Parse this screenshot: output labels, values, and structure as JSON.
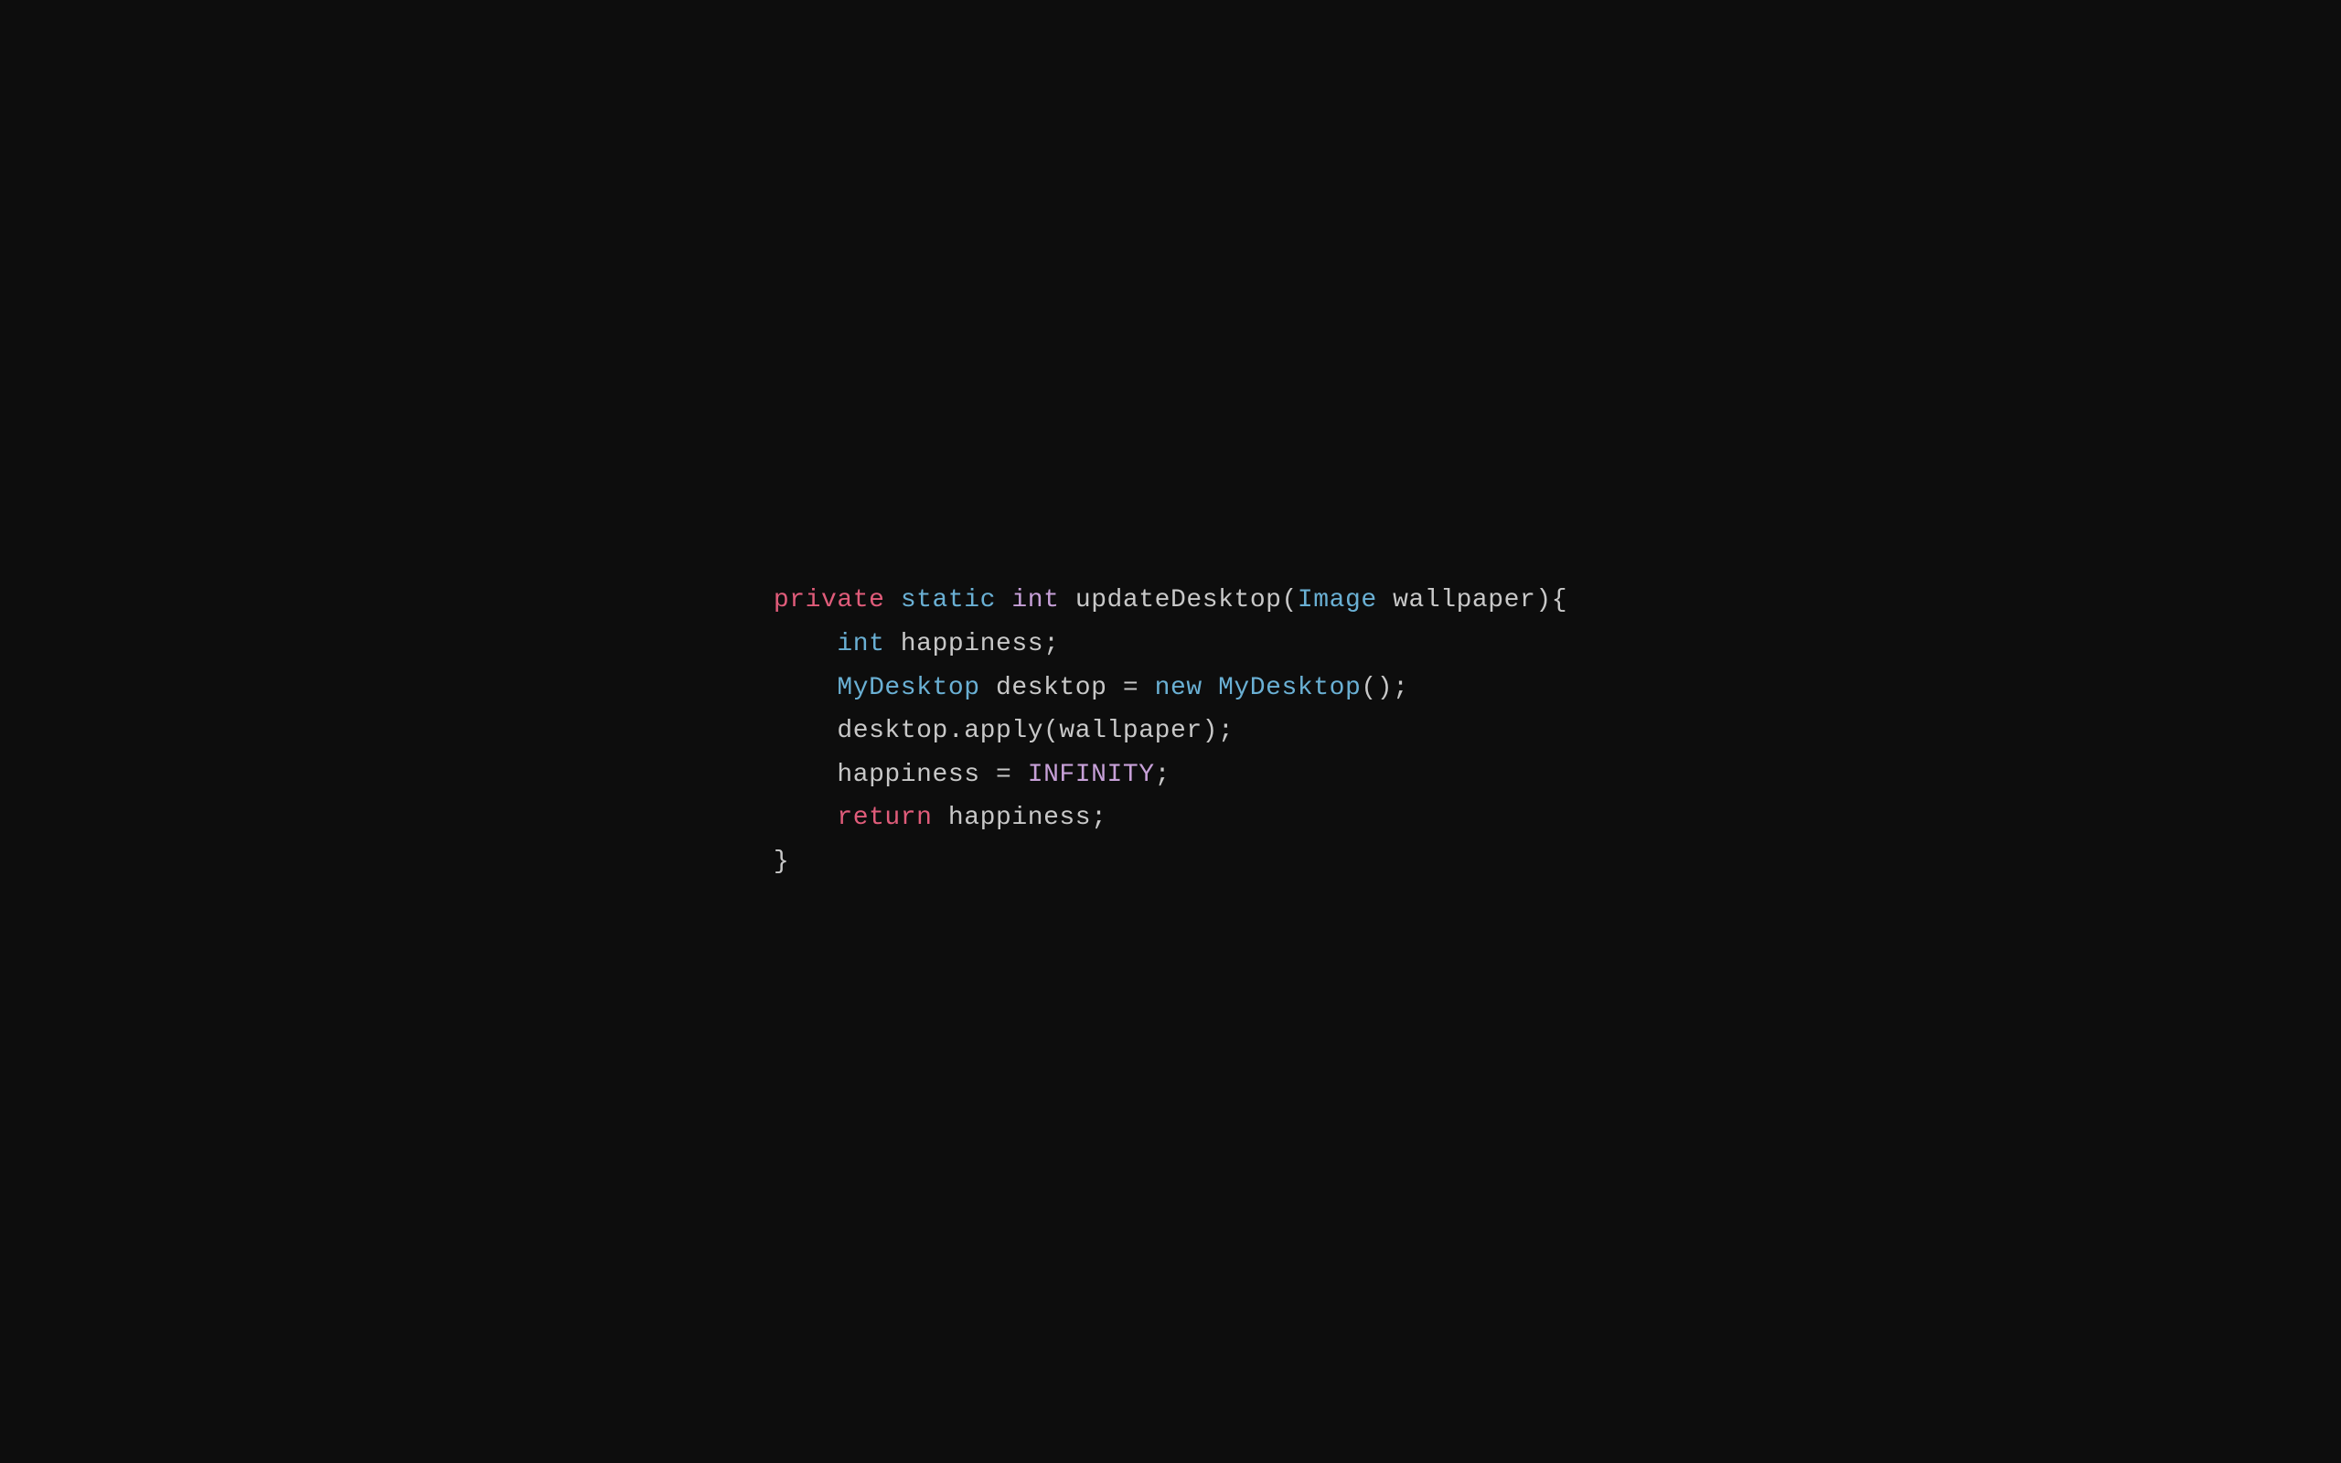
{
  "code": {
    "line1": {
      "kw_private": "private",
      "kw_static": "static",
      "kw_int": "int",
      "method": " updateDesktop(",
      "type_image": "Image",
      "params": " wallpaper){"
    },
    "line2": {
      "indent": "    ",
      "kw_int2": "int",
      "rest": " happiness;"
    },
    "line3": {
      "indent": "    ",
      "type_mydesktop": "MyDesktop",
      "rest1": " desktop = ",
      "kw_new": "new",
      "type_mydesktop2": " MyDesktop",
      "rest2": "();"
    },
    "line4": {
      "indent": "    ",
      "rest": "desktop.apply(wallpaper);"
    },
    "line5": {
      "indent": "    ",
      "var": "happiness",
      "eq": " = ",
      "const": "INFINITY",
      "semi": ";"
    },
    "line6": {
      "indent": "    ",
      "kw_return": "return",
      "rest": " happiness;"
    },
    "line7": {
      "brace": "}"
    }
  }
}
